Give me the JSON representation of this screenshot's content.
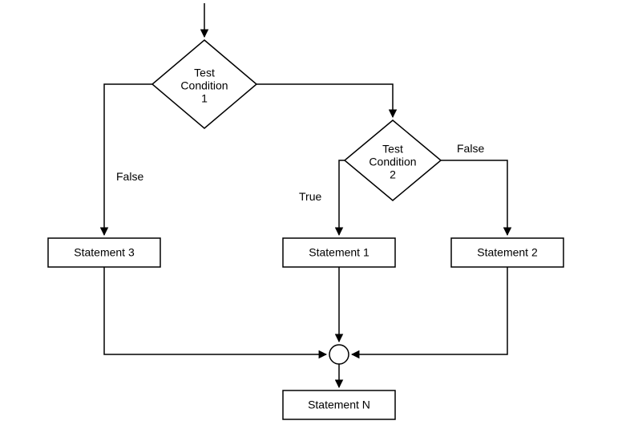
{
  "flowchart": {
    "nodes": {
      "condition1": {
        "line1": "Test",
        "line2": "Condition",
        "line3": "1"
      },
      "condition2": {
        "line1": "Test",
        "line2": "Condition",
        "line3": "2"
      },
      "stmt1": "Statement 1",
      "stmt2": "Statement 2",
      "stmt3": "Statement 3",
      "stmtN": "Statement N"
    },
    "edges": {
      "cond1_false": "False",
      "cond2_true": "True",
      "cond2_false": "False"
    }
  }
}
